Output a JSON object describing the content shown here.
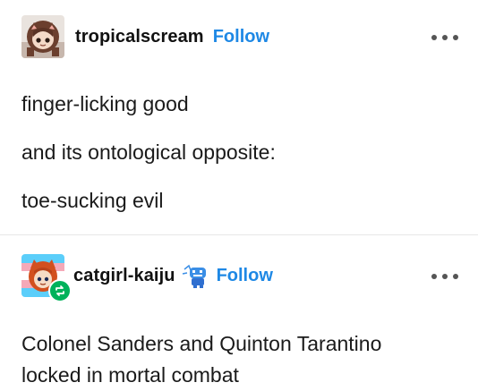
{
  "posts": [
    {
      "username": "tropicalscream",
      "follow_label": "Follow",
      "avatar_icon": "avatar-cartoon-brown-hair",
      "paragraphs": [
        "finger-licking good",
        "and its ontological opposite:",
        "toe-sucking evil"
      ]
    },
    {
      "username": "catgirl-kaiju",
      "follow_label": "Follow",
      "avatar_icon": "avatar-cartoon-orange-hair-trans-flag",
      "badge_icon": "blue-monster-badge-icon",
      "reblog_icon": "reblog-icon",
      "paragraphs": [
        "Colonel Sanders and Quinton Tarantino",
        "locked in mortal combat"
      ]
    }
  ],
  "colors": {
    "follow": "#1e88e5",
    "reblog_badge": "#00b25b",
    "divider": "#e6e6e6"
  },
  "more_icon": "ellipsis-icon"
}
